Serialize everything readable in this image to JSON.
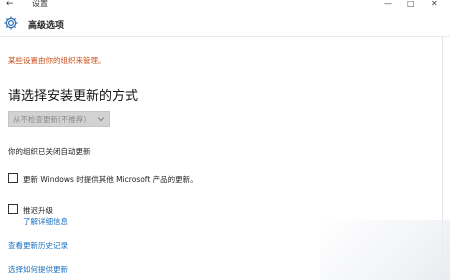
{
  "window": {
    "title": "设置",
    "controls": {
      "minimize": "—",
      "maximize": "□",
      "close": "✕"
    },
    "back": "←"
  },
  "header": {
    "title": "高级选项",
    "icon": "gear-icon"
  },
  "notice": {
    "text": "某些设置由你的组织来管理。",
    "color": "#c8511b"
  },
  "section": {
    "heading": "请选择安装更新的方式",
    "dropdown_value": "从不检查更新(不推荐)",
    "subtitle": "你的组织已关闭自动更新"
  },
  "options": [
    {
      "label": "更新 Windows 时提供其他 Microsoft 产品的更新。",
      "checked": false
    },
    {
      "label": "推迟升级",
      "checked": false
    }
  ],
  "links": {
    "learn_more": "了解详细信息",
    "view_history": "查看更新历史记录",
    "choose_delivery": "选择如何提供更新"
  },
  "colors": {
    "link": "#1a6fc1",
    "accent": "#1a6fc1"
  }
}
